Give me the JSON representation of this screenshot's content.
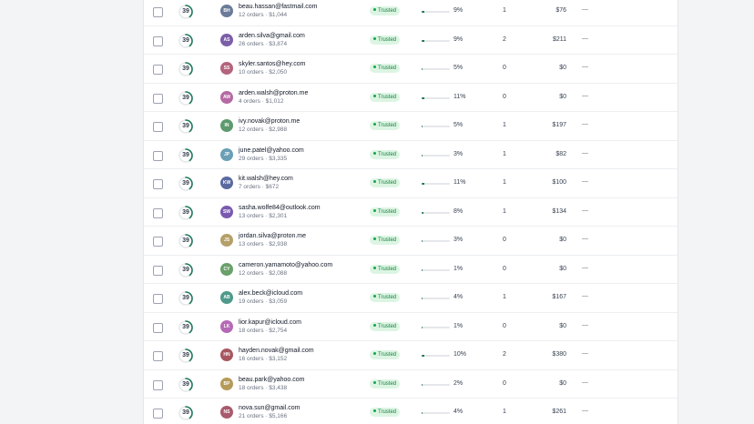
{
  "rows": [
    {
      "score": "39",
      "score_pct": 0.39,
      "initials": "BH",
      "avatar_color": "#6b7a99",
      "email": "beau.hassan@fastmail.com",
      "meta": "12 orders · $1,044",
      "badge": "Trusted",
      "rate_pct": 0.09,
      "rate": "9%",
      "count": "1",
      "amount": "$76",
      "action": "—"
    },
    {
      "score": "39",
      "score_pct": 0.39,
      "initials": "AS",
      "avatar_color": "#7c5ea8",
      "email": "arden.silva@gmail.com",
      "meta": "26 orders · $3,874",
      "badge": "Trusted",
      "rate_pct": 0.09,
      "rate": "9%",
      "count": "2",
      "amount": "$211",
      "action": "—"
    },
    {
      "score": "39",
      "score_pct": 0.39,
      "initials": "SS",
      "avatar_color": "#b5647e",
      "email": "skyler.santos@hey.com",
      "meta": "10 orders · $2,050",
      "badge": "Trusted",
      "rate_pct": 0.05,
      "rate": "5%",
      "count": "0",
      "amount": "$0",
      "action": "—"
    },
    {
      "score": "39",
      "score_pct": 0.39,
      "initials": "AW",
      "avatar_color": "#b56aa3",
      "email": "arden.walsh@proton.me",
      "meta": "4 orders · $1,012",
      "badge": "Trusted",
      "rate_pct": 0.11,
      "rate": "11%",
      "count": "0",
      "amount": "$0",
      "action": "—"
    },
    {
      "score": "39",
      "score_pct": 0.39,
      "initials": "IN",
      "avatar_color": "#5e9a6e",
      "email": "ivy.novak@proton.me",
      "meta": "12 orders · $2,988",
      "badge": "Trusted",
      "rate_pct": 0.05,
      "rate": "5%",
      "count": "1",
      "amount": "$197",
      "action": "—"
    },
    {
      "score": "39",
      "score_pct": 0.39,
      "initials": "JP",
      "avatar_color": "#6a9fb5",
      "email": "june.patel@yahoo.com",
      "meta": "29 orders · $3,335",
      "badge": "Trusted",
      "rate_pct": 0.03,
      "rate": "3%",
      "count": "1",
      "amount": "$82",
      "action": "—"
    },
    {
      "score": "39",
      "score_pct": 0.39,
      "initials": "KW",
      "avatar_color": "#5a6aa0",
      "email": "kit.walsh@hey.com",
      "meta": "7 orders · $672",
      "badge": "Trusted",
      "rate_pct": 0.11,
      "rate": "11%",
      "count": "1",
      "amount": "$100",
      "action": "—"
    },
    {
      "score": "39",
      "score_pct": 0.39,
      "initials": "SW",
      "avatar_color": "#7a5ab0",
      "email": "sasha.wolfe84@outlook.com",
      "meta": "13 orders · $2,301",
      "badge": "Trusted",
      "rate_pct": 0.08,
      "rate": "8%",
      "count": "1",
      "amount": "$134",
      "action": "—"
    },
    {
      "score": "39",
      "score_pct": 0.39,
      "initials": "JS",
      "avatar_color": "#b5a06a",
      "email": "jordan.silva@proton.me",
      "meta": "13 orders · $2,938",
      "badge": "Trusted",
      "rate_pct": 0.03,
      "rate": "3%",
      "count": "0",
      "amount": "$0",
      "action": "—"
    },
    {
      "score": "39",
      "score_pct": 0.39,
      "initials": "CY",
      "avatar_color": "#6aa06a",
      "email": "cameron.yamamoto@yahoo.com",
      "meta": "12 orders · $2,088",
      "badge": "Trusted",
      "rate_pct": 0.01,
      "rate": "1%",
      "count": "0",
      "amount": "$0",
      "action": "—"
    },
    {
      "score": "39",
      "score_pct": 0.39,
      "initials": "AB",
      "avatar_color": "#4f9a8a",
      "email": "alex.beck@icloud.com",
      "meta": "19 orders · $3,059",
      "badge": "Trusted",
      "rate_pct": 0.04,
      "rate": "4%",
      "count": "1",
      "amount": "$167",
      "action": "—"
    },
    {
      "score": "39",
      "score_pct": 0.39,
      "initials": "LK",
      "avatar_color": "#b56ab5",
      "email": "lior.kapur@icloud.com",
      "meta": "18 orders · $2,754",
      "badge": "Trusted",
      "rate_pct": 0.01,
      "rate": "1%",
      "count": "0",
      "amount": "$0",
      "action": "—"
    },
    {
      "score": "39",
      "score_pct": 0.39,
      "initials": "HN",
      "avatar_color": "#a8565e",
      "email": "hayden.novak@gmail.com",
      "meta": "16 orders · $3,152",
      "badge": "Trusted",
      "rate_pct": 0.1,
      "rate": "10%",
      "count": "2",
      "amount": "$380",
      "action": "—"
    },
    {
      "score": "39",
      "score_pct": 0.39,
      "initials": "BP",
      "avatar_color": "#b59a5a",
      "email": "beau.park@yahoo.com",
      "meta": "18 orders · $3,438",
      "badge": "Trusted",
      "rate_pct": 0.02,
      "rate": "2%",
      "count": "0",
      "amount": "$0",
      "action": "—"
    },
    {
      "score": "39",
      "score_pct": 0.39,
      "initials": "NS",
      "avatar_color": "#a85a6e",
      "email": "nova.sun@gmail.com",
      "meta": "21 orders · $5,166",
      "badge": "Trusted",
      "rate_pct": 0.04,
      "rate": "4%",
      "count": "1",
      "amount": "$261",
      "action": "—"
    }
  ],
  "colors": {
    "badge_bg": "#dcf5e3",
    "badge_text": "#15803d",
    "ring": "#1f7a5a",
    "ring_track": "#e5e7eb",
    "bar_fill": "#1f7a5a"
  },
  "icons": {
    "checkbox": "checkbox-icon",
    "score_ring": "score-ring-icon",
    "badge_dot": "status-dot-icon"
  }
}
